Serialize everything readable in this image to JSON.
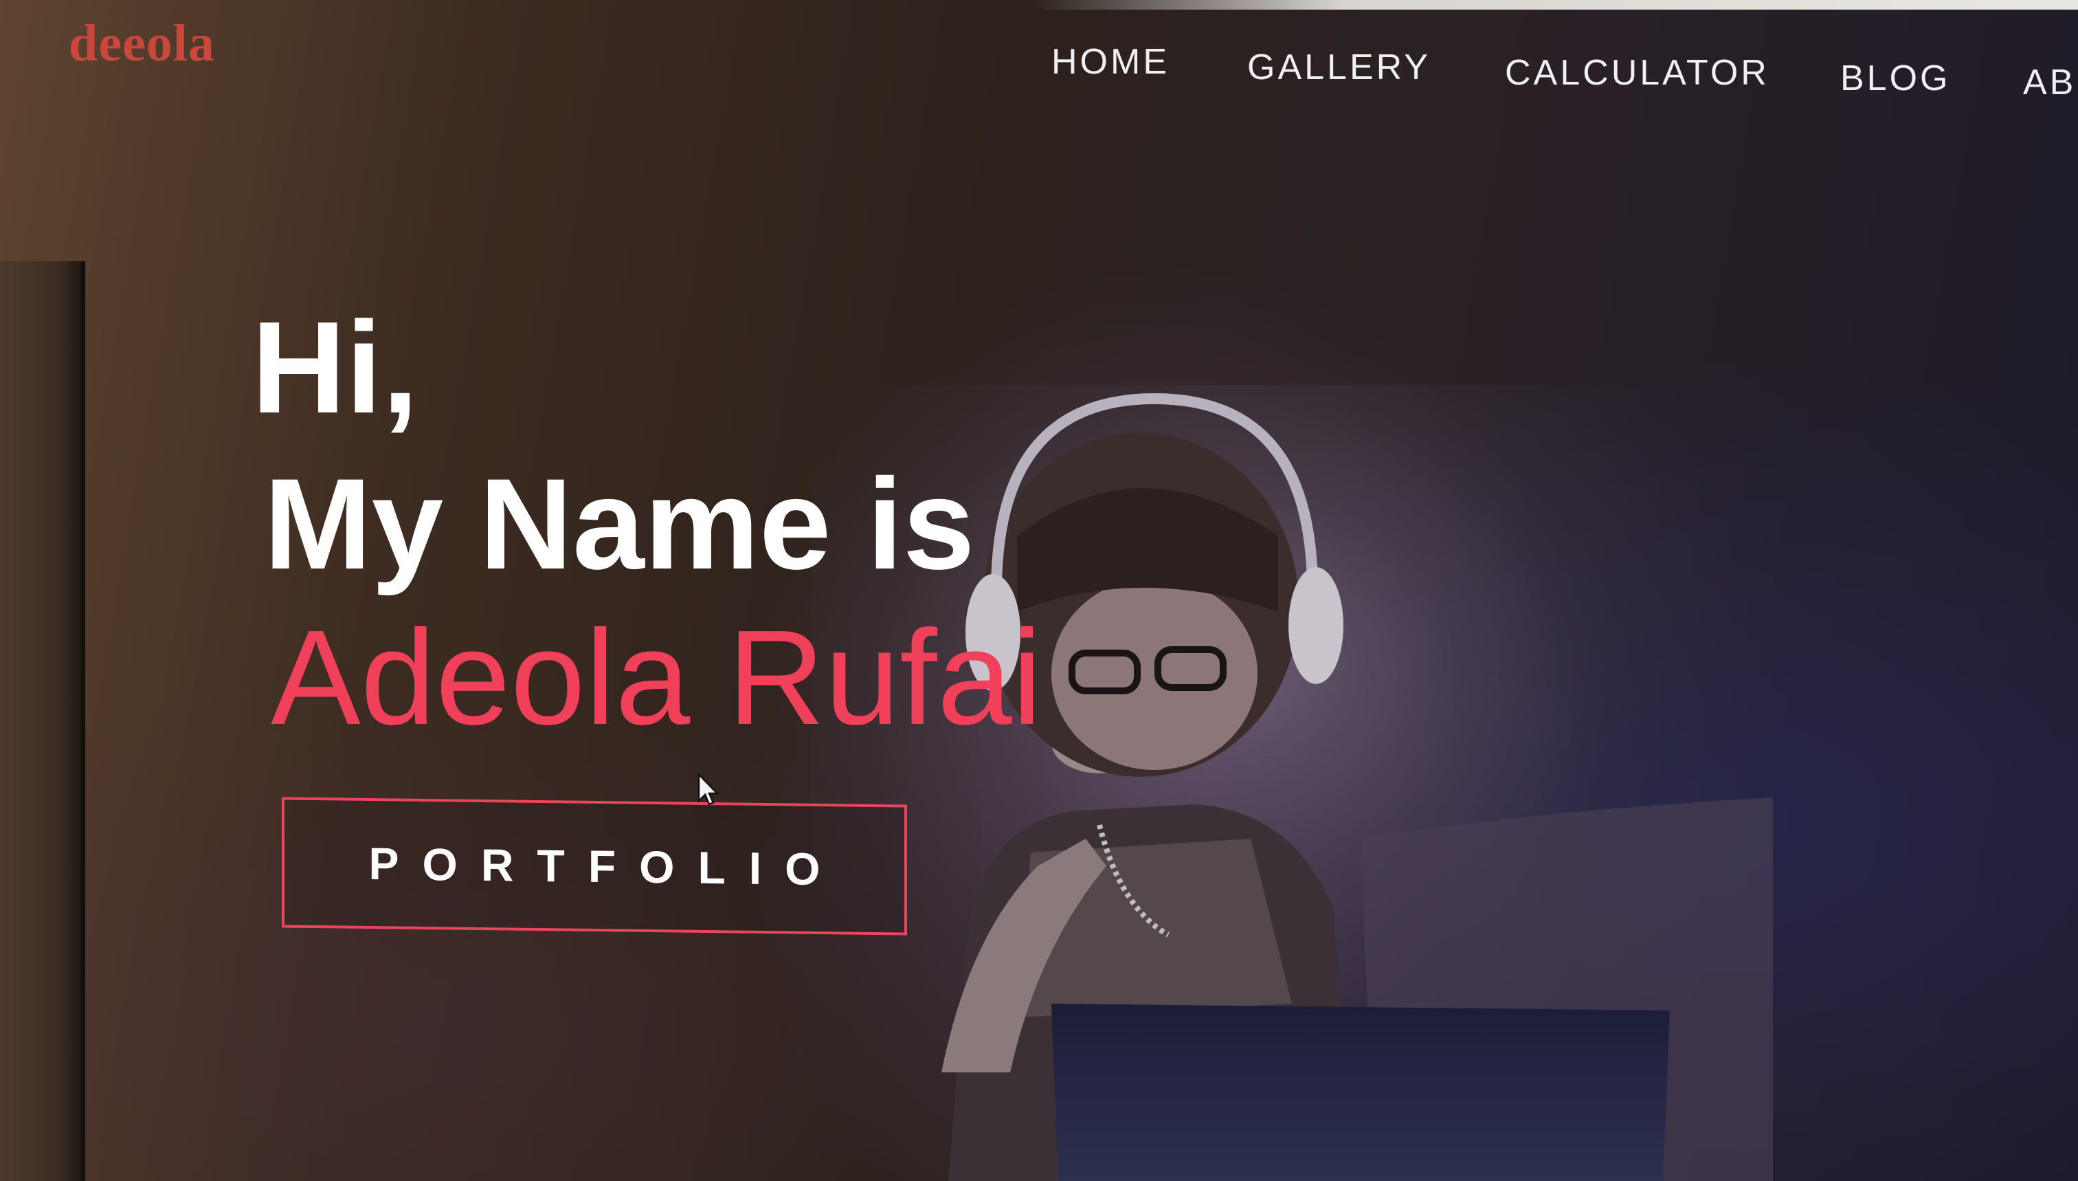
{
  "site": {
    "logo_text": "deeola"
  },
  "nav": {
    "items": [
      {
        "label": "HOME"
      },
      {
        "label": "GALLERY"
      },
      {
        "label": "CALCULATOR"
      },
      {
        "label": "BLOG"
      },
      {
        "label": "AB"
      }
    ]
  },
  "hero": {
    "greeting": "Hi,",
    "intro": "My Name is",
    "name": "Adeola Rufai",
    "cta_label": "PORTFOLIO"
  },
  "colors": {
    "accent": "#f0405a",
    "logo": "#c9473c",
    "text": "#ffffff"
  },
  "icons": {
    "pointer": "mouse-pointer-icon"
  }
}
